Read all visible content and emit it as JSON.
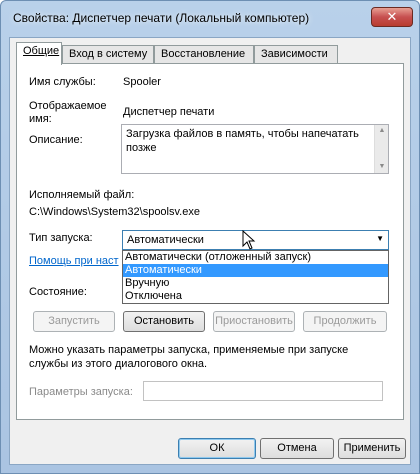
{
  "window": {
    "title": "Свойства: Диспетчер печати (Локальный компьютер)",
    "close_label": "✕"
  },
  "tabs": [
    {
      "label": "Общие"
    },
    {
      "label": "Вход в систему"
    },
    {
      "label": "Восстановление"
    },
    {
      "label": "Зависимости"
    }
  ],
  "general": {
    "service_name_label": "Имя службы:",
    "service_name": "Spooler",
    "display_name_label_1": "Отображаемое",
    "display_name_label_2": "имя:",
    "display_name": "Диспетчер печати",
    "description_label": "Описание:",
    "description": "Загрузка файлов в память, чтобы напечатать позже",
    "exe_label": "Исполняемый файл:",
    "exe_path": "C:\\Windows\\System32\\spoolsv.exe",
    "startup_label": "Тип запуска:",
    "startup_value": "Автоматически",
    "startup_options": [
      "Автоматически (отложенный запуск)",
      "Автоматически",
      "Вручную",
      "Отключена"
    ],
    "help_link": "Помощь при наст",
    "status_label": "Состояние:",
    "buttons": {
      "start": "Запустить",
      "stop": "Остановить",
      "pause": "Приостановить",
      "resume": "Продолжить"
    },
    "hint_line1": "Можно указать параметры запуска, применяемые при запуске",
    "hint_line2": "службы из этого диалогового окна.",
    "params_label": "Параметры запуска:",
    "params_value": ""
  },
  "footer": {
    "ok": "ОК",
    "cancel": "Отмена",
    "apply": "Применить"
  }
}
